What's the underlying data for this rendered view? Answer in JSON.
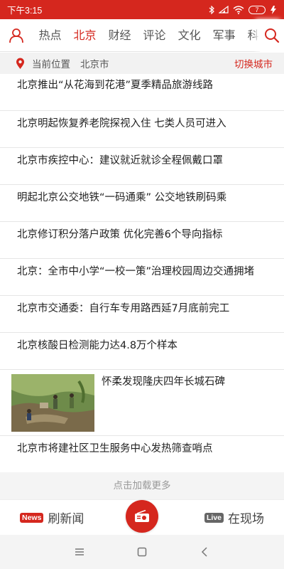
{
  "status": {
    "time": "下午3:15",
    "battery": "7"
  },
  "topnav": {
    "tabs": [
      {
        "label": "热点"
      },
      {
        "label": "北京"
      },
      {
        "label": "财经"
      },
      {
        "label": "评论"
      },
      {
        "label": "文化"
      },
      {
        "label": "军事"
      },
      {
        "label": "科"
      }
    ],
    "active_tab": "北京"
  },
  "location": {
    "label": "当前位置",
    "city": "北京市",
    "switch_label": "切换城市"
  },
  "news": {
    "items": [
      {
        "title": "北京推出“从花海到花港”夏季精品旅游线路"
      },
      {
        "title": "北京明起恢复养老院探视入住 七类人员可进入"
      },
      {
        "title": "北京市疾控中心：建议就近就诊全程佩戴口罩"
      },
      {
        "title": "明起北京公交地铁“一码通乘” 公交地铁刷码乘"
      },
      {
        "title": "北京修订积分落户政策 优化完善6个导向指标"
      },
      {
        "title": "北京：全市中小学“一校一策”治理校园周边交通拥堵"
      },
      {
        "title": "北京市交通委：自行车专用路西延7月底前完工"
      },
      {
        "title": "北京核酸日检测能力达4.8万个样本"
      },
      {
        "title": "怀柔发现隆庆四年长城石碑",
        "has_image": true
      },
      {
        "title": "北京市将建社区卫生服务中心发热筛查哨点"
      }
    ]
  },
  "load_more": "点击加载更多",
  "bottombar": {
    "left_badge": "News",
    "left_label": "刷新闻",
    "right_badge": "Live",
    "right_label": "在现场"
  },
  "colors": {
    "brand": "#d5271e",
    "text": "#222222",
    "muted": "#999999"
  },
  "icons": [
    "user-icon",
    "search-icon",
    "location-pin-icon",
    "radio-icon",
    "menu-icon",
    "home-icon",
    "back-icon"
  ]
}
